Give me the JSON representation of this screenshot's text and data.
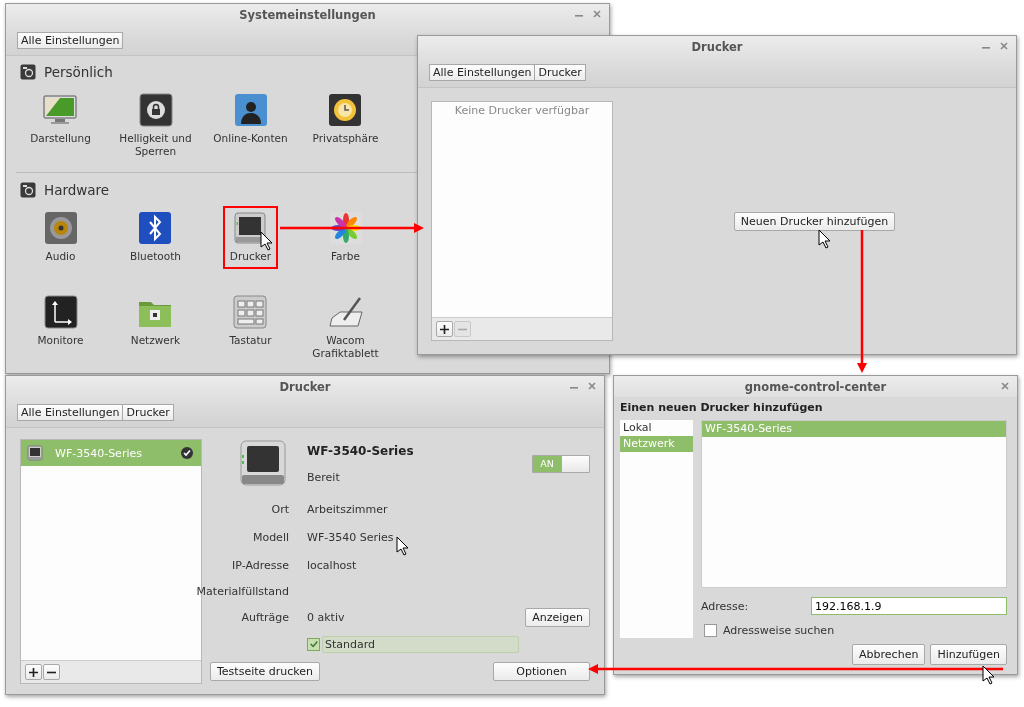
{
  "settings_window": {
    "title": "Systemeinstellungen",
    "breadcrumbs": [
      "Alle Einstellungen"
    ],
    "sections": [
      {
        "title": "Persönlich",
        "items": [
          {
            "label": "Darstellung",
            "highlighted": false
          },
          {
            "label": "Helligkeit und Sperren",
            "highlighted": false
          },
          {
            "label": "Online-Konten",
            "highlighted": false
          },
          {
            "label": "Privatsphäre",
            "highlighted": false
          }
        ]
      },
      {
        "title": "Hardware",
        "items": [
          {
            "label": "Audio",
            "highlighted": false
          },
          {
            "label": "Bluetooth",
            "highlighted": false
          },
          {
            "label": "Drucker",
            "highlighted": true
          },
          {
            "label": "Farbe",
            "highlighted": false
          },
          {
            "label": "Monitore",
            "highlighted": false
          },
          {
            "label": "Netzwerk",
            "highlighted": false
          },
          {
            "label": "Tastatur",
            "highlighted": false
          },
          {
            "label": "Wacom Grafiktablett",
            "highlighted": false
          }
        ]
      }
    ]
  },
  "printers_empty_window": {
    "title": "Drucker",
    "breadcrumbs": [
      "Alle Einstellungen",
      "Drucker"
    ],
    "empty_text": "Keine Drucker verfügbar",
    "remove_enabled": false,
    "add_button": "Neuen Drucker hinzufügen"
  },
  "printers_window": {
    "title": "Drucker",
    "breadcrumbs": [
      "Alle Einstellungen",
      "Drucker"
    ],
    "remove_enabled": true,
    "printers": [
      {
        "name": "WF-3540-Series",
        "selected": true,
        "default": true
      }
    ],
    "detail": {
      "name": "WF-3540-Series",
      "status": "Bereit",
      "toggle": {
        "label": "AN",
        "on": true
      },
      "fields": [
        {
          "label": "Ort",
          "value": "Arbeitszimmer"
        },
        {
          "label": "Modell",
          "value": "WF-3540 Series"
        },
        {
          "label": "IP-Adresse",
          "value": "localhost"
        },
        {
          "label": "Materialfüllstand"
        },
        {
          "label": "Aufträge",
          "value": "0 aktiv",
          "button": "Anzeigen"
        }
      ],
      "default_checkbox": {
        "label": "Standard",
        "checked": true
      },
      "test_button": "Testseite drucken",
      "options_button": "Optionen"
    }
  },
  "add_printer_dialog": {
    "title": "gnome-control-center",
    "heading": "Einen neuen Drucker hinzufügen",
    "sources": [
      {
        "label": "Lokal",
        "selected": false
      },
      {
        "label": "Netzwerk",
        "selected": true
      }
    ],
    "devices": [
      {
        "name": "WF-3540-Series",
        "selected": true
      }
    ],
    "address": {
      "label": "Adresse:",
      "value": "192.168.1.9"
    },
    "search_checkbox": {
      "label": "Adressweise suchen",
      "checked": false
    },
    "buttons": [
      "Abbrechen",
      "Hinzufügen"
    ]
  }
}
